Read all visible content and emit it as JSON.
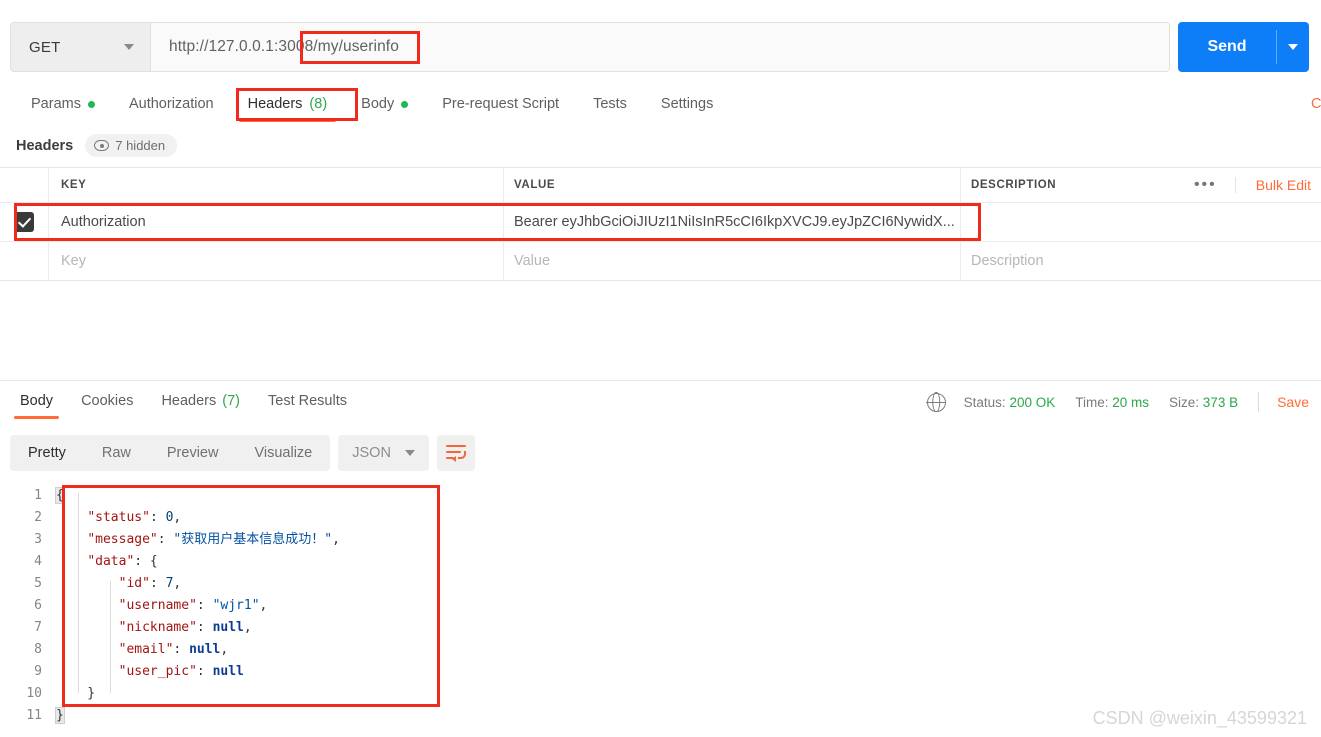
{
  "request": {
    "method": "GET",
    "url": "http://127.0.0.1:3008/my/userinfo",
    "send_label": "Send",
    "tabs": [
      {
        "label": "Params",
        "dot": true,
        "count": null,
        "active": false
      },
      {
        "label": "Authorization",
        "dot": false,
        "count": null,
        "active": false
      },
      {
        "label": "Headers",
        "dot": false,
        "count": "(8)",
        "active": true
      },
      {
        "label": "Body",
        "dot": true,
        "count": null,
        "active": false
      },
      {
        "label": "Pre-request Script",
        "dot": false,
        "count": null,
        "active": false
      },
      {
        "label": "Tests",
        "dot": false,
        "count": null,
        "active": false
      },
      {
        "label": "Settings",
        "dot": false,
        "count": null,
        "active": false
      }
    ],
    "cookies_cut_label": "Cookies",
    "headers_section": {
      "title": "Headers",
      "hidden_badge": "7 hidden",
      "columns": {
        "key": "KEY",
        "value": "VALUE",
        "description": "DESCRIPTION"
      },
      "bulk_edit_label": "Bulk Edit",
      "more_label": "•••",
      "rows": [
        {
          "checked": true,
          "key": "Authorization",
          "value": "Bearer eyJhbGciOiJIUzI1NiIsInR5cCI6IkpXVCJ9.eyJpZCI6NywidX...",
          "description": ""
        }
      ],
      "placeholders": {
        "key": "Key",
        "value": "Value",
        "description": "Description"
      }
    }
  },
  "response": {
    "tabs": [
      {
        "label": "Body",
        "count": null,
        "active": true
      },
      {
        "label": "Cookies",
        "count": null,
        "active": false
      },
      {
        "label": "Headers",
        "count": "(7)",
        "active": false
      },
      {
        "label": "Test Results",
        "count": null,
        "active": false
      }
    ],
    "meta": {
      "status_label": "Status:",
      "status_value": "200 OK",
      "time_label": "Time:",
      "time_value": "20 ms",
      "size_label": "Size:",
      "size_value": "373 B",
      "save_label": "Save"
    },
    "format_tabs": [
      {
        "label": "Pretty",
        "active": true
      },
      {
        "label": "Raw",
        "active": false
      },
      {
        "label": "Preview",
        "active": false
      },
      {
        "label": "Visualize",
        "active": false
      }
    ],
    "format_selected": "JSON",
    "body_lines": [
      {
        "no": "1",
        "code": "{"
      },
      {
        "no": "2",
        "code": "    \"status\": 0,"
      },
      {
        "no": "3",
        "code": "    \"message\": \"获取用户基本信息成功！\","
      },
      {
        "no": "4",
        "code": "    \"data\": {"
      },
      {
        "no": "5",
        "code": "        \"id\": 7,"
      },
      {
        "no": "6",
        "code": "        \"username\": \"wjr1\","
      },
      {
        "no": "7",
        "code": "        \"nickname\": null,"
      },
      {
        "no": "8",
        "code": "        \"email\": null,"
      },
      {
        "no": "9",
        "code": "        \"user_pic\": null"
      },
      {
        "no": "10",
        "code": "    }"
      },
      {
        "no": "11",
        "code": "}"
      }
    ],
    "body_json": {
      "status": 0,
      "message": "获取用户基本信息成功！",
      "data": {
        "id": 7,
        "username": "wjr1",
        "nickname": null,
        "email": null,
        "user_pic": null
      }
    }
  },
  "annotations": {
    "color": "#f12a1e",
    "boxes": [
      "url-path",
      "headers-tab",
      "authorization-row",
      "response-body-json"
    ]
  },
  "watermark": "CSDN @weixin_43599321",
  "colors": {
    "accent_orange": "#ff6c37",
    "send_blue": "#0d7ef7",
    "status_green": "#2aa84a",
    "annotation_red": "#f12a1e"
  }
}
